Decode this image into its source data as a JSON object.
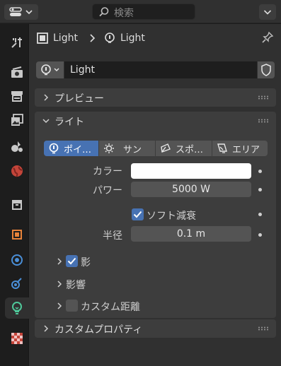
{
  "header": {
    "search_placeholder": "検索"
  },
  "tabs": [
    {
      "name": "tool"
    },
    {
      "name": "render"
    },
    {
      "name": "output"
    },
    {
      "name": "view-layer"
    },
    {
      "name": "scene"
    },
    {
      "name": "world"
    },
    {
      "name": "collection"
    },
    {
      "name": "object"
    },
    {
      "name": "modifiers"
    },
    {
      "name": "physics"
    },
    {
      "name": "object-data-light",
      "active": true
    },
    {
      "name": "texture"
    }
  ],
  "breadcrumb": {
    "object": "Light",
    "data": "Light"
  },
  "datablock": {
    "name": "Light"
  },
  "panels": {
    "preview": "プレビュー",
    "light": "ライト",
    "custom_props": "カスタムプロパティ"
  },
  "light_types": [
    {
      "label": "ポイ…",
      "active": true
    },
    {
      "label": "サン",
      "active": false
    },
    {
      "label": "スポ…",
      "active": false
    },
    {
      "label": "エリア",
      "active": false
    }
  ],
  "props": {
    "color_label": "カラー",
    "color_value": "#ffffff",
    "power_label": "パワー",
    "power_value": "5000 W",
    "soft_falloff_label": "ソフト減衰",
    "soft_falloff_checked": true,
    "radius_label": "半径",
    "radius_value": "0.1 m"
  },
  "subpanels": {
    "shadow": "影",
    "shadow_checked": true,
    "influence": "影響",
    "custom_distance": "カスタム距離",
    "custom_distance_checked": false
  },
  "colors": {
    "accent": "#4772b3",
    "panel": "#3d3d3d",
    "bg": "#303030"
  }
}
